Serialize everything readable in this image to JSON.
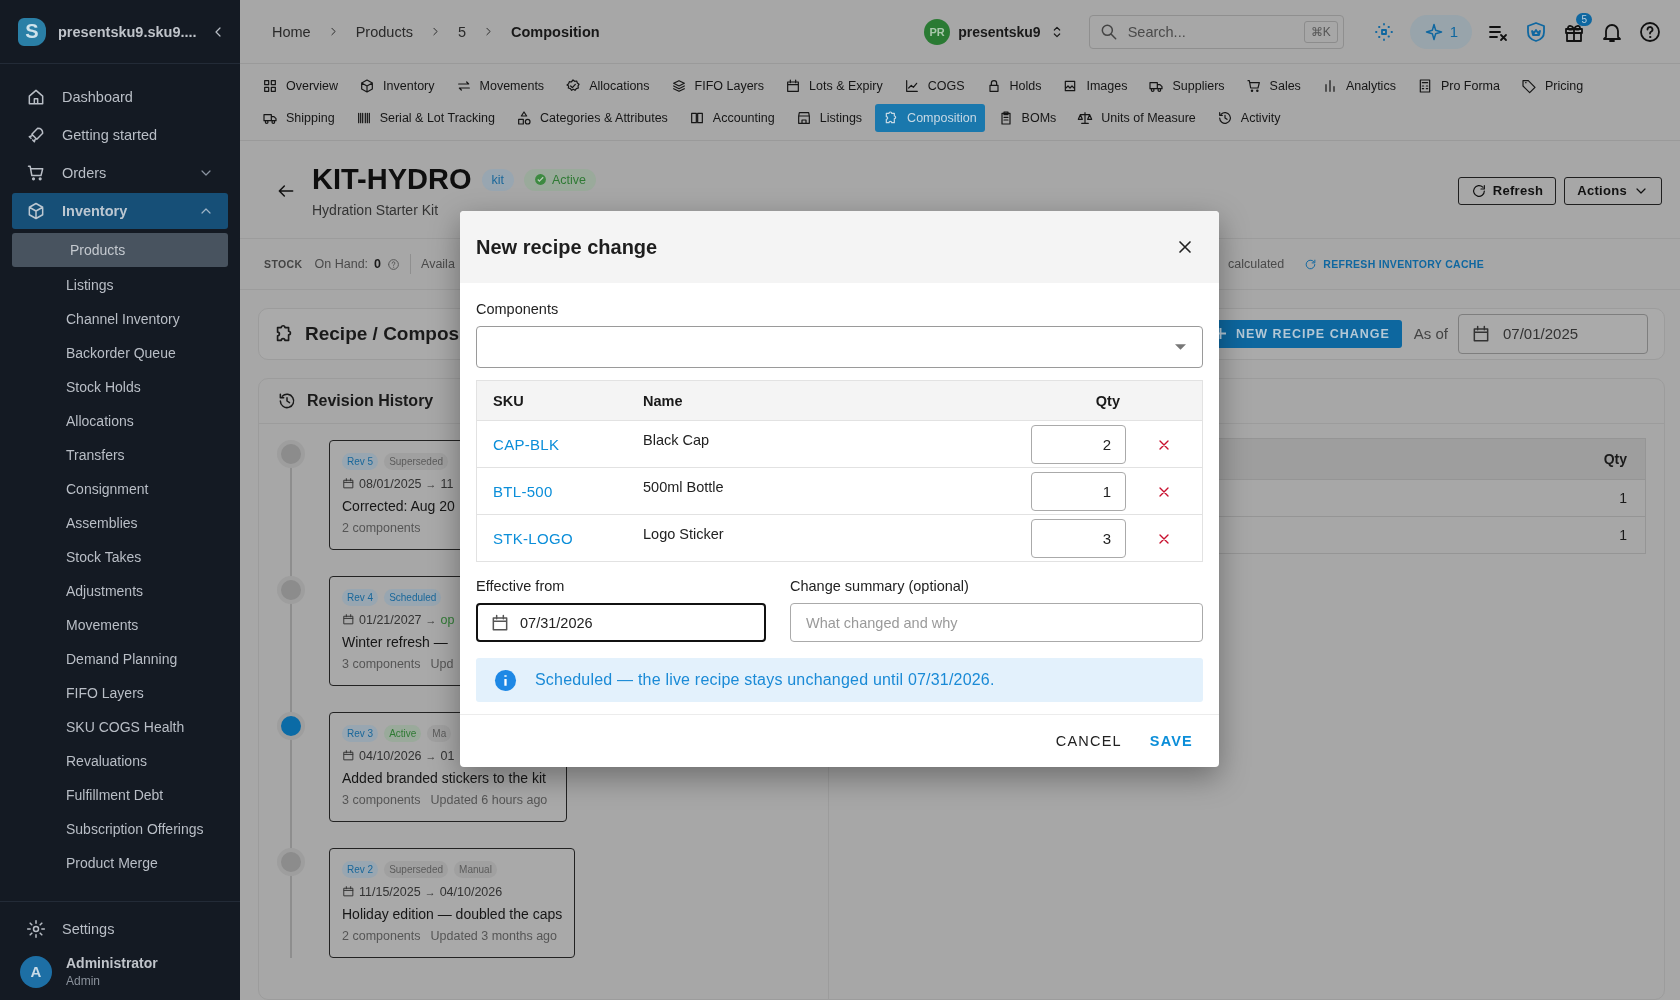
{
  "sidebar": {
    "logo_letter": "S",
    "workspace": "presentsku9.sku9....",
    "items": [
      {
        "label": "Dashboard",
        "selected": false
      },
      {
        "label": "Getting started",
        "selected": false
      },
      {
        "label": "Orders",
        "selected": false,
        "expanded": false
      },
      {
        "label": "Inventory",
        "selected": true,
        "expanded": true,
        "children": [
          {
            "label": "Products",
            "selected": true
          },
          {
            "label": "Listings",
            "selected": false
          },
          {
            "label": "Channel Inventory",
            "selected": false
          },
          {
            "label": "Backorder Queue",
            "selected": false
          },
          {
            "label": "Stock Holds",
            "selected": false
          },
          {
            "label": "Allocations",
            "selected": false
          },
          {
            "label": "Transfers",
            "selected": false
          },
          {
            "label": "Consignment",
            "selected": false
          },
          {
            "label": "Assemblies",
            "selected": false
          },
          {
            "label": "Stock Takes",
            "selected": false
          },
          {
            "label": "Adjustments",
            "selected": false
          },
          {
            "label": "Movements",
            "selected": false
          },
          {
            "label": "Demand Planning",
            "selected": false
          },
          {
            "label": "FIFO Layers",
            "selected": false
          },
          {
            "label": "SKU COGS Health",
            "selected": false
          },
          {
            "label": "Revaluations",
            "selected": false
          },
          {
            "label": "Fulfillment Debt",
            "selected": false
          },
          {
            "label": "Subscription Offerings",
            "selected": false
          },
          {
            "label": "Product Merge",
            "selected": false
          }
        ]
      }
    ],
    "settings": "Settings",
    "user": {
      "initial": "A",
      "name": "Administrator",
      "role": "Admin"
    }
  },
  "breadcrumb": [
    "Home",
    "Products",
    "5",
    "Composition"
  ],
  "org": {
    "initials": "PR",
    "name": "presentsku9"
  },
  "search": {
    "placeholder": "Search...",
    "shortcut": "⌘K"
  },
  "assistant_count": "1",
  "gift_badge": "5",
  "tabs": [
    {
      "label": "Overview",
      "selected": false
    },
    {
      "label": "Inventory",
      "selected": false
    },
    {
      "label": "Movements",
      "selected": false
    },
    {
      "label": "Allocations",
      "selected": false
    },
    {
      "label": "FIFO Layers",
      "selected": false
    },
    {
      "label": "Lots & Expiry",
      "selected": false
    },
    {
      "label": "COGS",
      "selected": false
    },
    {
      "label": "Holds",
      "selected": false
    },
    {
      "label": "Images",
      "selected": false
    },
    {
      "label": "Suppliers",
      "selected": false
    },
    {
      "label": "Sales",
      "selected": false
    },
    {
      "label": "Analytics",
      "selected": false
    },
    {
      "label": "Pro Forma",
      "selected": false
    },
    {
      "label": "Pricing",
      "selected": false
    },
    {
      "label": "Shipping",
      "selected": false
    },
    {
      "label": "Serial & Lot Tracking",
      "selected": false
    },
    {
      "label": "Categories & Attributes",
      "selected": false
    },
    {
      "label": "Accounting",
      "selected": false
    },
    {
      "label": "Listings",
      "selected": false
    },
    {
      "label": "Composition",
      "selected": true
    },
    {
      "label": "BOMs",
      "selected": false
    },
    {
      "label": "Units of Measure",
      "selected": false
    },
    {
      "label": "Activity",
      "selected": false
    }
  ],
  "product": {
    "sku": "KIT-HYDRO",
    "type_chip": "kit",
    "status": "Active",
    "name": "Hydration Starter Kit"
  },
  "header_buttons": {
    "refresh": "Refresh",
    "actions": "Actions"
  },
  "stock_bar": {
    "label": "STOCK",
    "on_hand_label": "On Hand:",
    "on_hand": "0",
    "available": "Availa",
    "calculated": "calculated",
    "refresh_cache": "REFRESH INVENTORY CACHE"
  },
  "recipe": {
    "title": "Recipe / Compos",
    "new_button": "NEW RECIPE CHANGE",
    "as_of_label": "As of",
    "as_of": "07/01/2025"
  },
  "revision_history": {
    "title": "Revision History",
    "revisions": [
      {
        "rev": "Rev 5",
        "status": "Superseded",
        "color": "#5b5b5b",
        "from": "08/01/2025",
        "arrow": "→",
        "to": "11",
        "open": false,
        "summary": "Corrected: Aug 20",
        "components": "2 components",
        "current": false
      },
      {
        "rev": "Rev 4",
        "status": "Scheduled",
        "color": "#19679a",
        "from": "01/21/2027",
        "arrow": "→",
        "to": "op",
        "open": true,
        "summary": "Winter refresh —",
        "components": "3 components",
        "updated": "Upd",
        "current": false
      },
      {
        "rev": "Rev 3",
        "status": "Active",
        "color": "#2f7a34",
        "source": "Ma",
        "from": "04/10/2026",
        "arrow": "→",
        "to": "01",
        "open": false,
        "summary": "Added branded stickers to the kit",
        "components": "3 components",
        "updated": "Updated 6 hours ago",
        "current": true
      },
      {
        "rev": "Rev 2",
        "status": "Superseded",
        "color": "#5b5b5b",
        "source": "Manual",
        "from": "11/15/2025",
        "arrow": "→",
        "to": "04/10/2026",
        "open": false,
        "summary": "Holiday edition — doubled the caps",
        "components": "2 components",
        "updated": "Updated 3 months ago",
        "current": false
      }
    ]
  },
  "recipe_table": {
    "columns": [
      "Qty"
    ],
    "rows": [
      [
        "1"
      ],
      [
        "1"
      ]
    ]
  },
  "dialog": {
    "title": "New recipe change",
    "components_label": "Components",
    "columns": [
      "SKU",
      "Name",
      "Qty"
    ],
    "rows": [
      {
        "sku": "CAP-BLK",
        "name": "Black Cap",
        "qty": "2"
      },
      {
        "sku": "BTL-500",
        "name": "500ml Bottle",
        "qty": "1"
      },
      {
        "sku": "STK-LOGO",
        "name": "Logo Sticker",
        "qty": "3"
      }
    ],
    "effective_label": "Effective from",
    "effective_value": "07/31/2026",
    "summary_label": "Change summary (optional)",
    "summary_placeholder": "What changed and why",
    "info": "Scheduled — the live recipe stays unchanged until 07/31/2026.",
    "cancel": "CANCEL",
    "save": "SAVE"
  }
}
